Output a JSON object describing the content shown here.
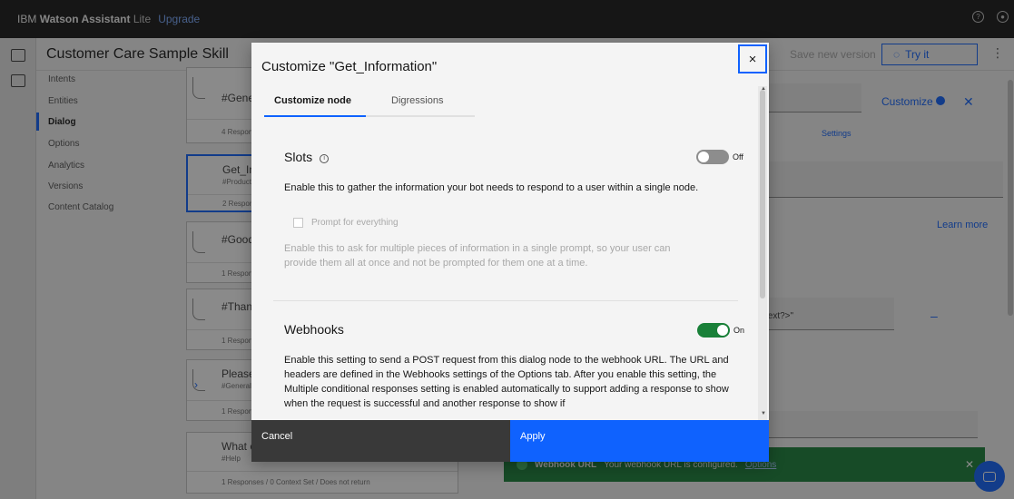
{
  "topbar": {
    "brand_company": "IBM",
    "brand_product": "Watson Assistant",
    "brand_plan": "Lite",
    "upgrade": "Upgrade",
    "help_icon": "help-icon",
    "user_icon": "user-icon"
  },
  "header": {
    "skill_title": "Customer Care Sample Skill",
    "save_version": "Save new version",
    "try_it": "Try it",
    "kebab": "⋮"
  },
  "subnav": {
    "items": [
      {
        "label": "Intents"
      },
      {
        "label": "Entities"
      },
      {
        "label": "Dialog"
      },
      {
        "label": "Options"
      },
      {
        "label": "Analytics"
      },
      {
        "label": "Versions"
      },
      {
        "label": "Content Catalog"
      }
    ]
  },
  "tree": {
    "nodes": [
      {
        "title": "#Gene",
        "condition": "",
        "footer": "4 Respon"
      },
      {
        "title": "Get_In",
        "condition": "#Product",
        "footer": "2 Respon"
      },
      {
        "title": "#Good",
        "condition": "",
        "footer": "1 Respon"
      },
      {
        "title": "#Thank",
        "condition": "",
        "footer": "1 Respon"
      },
      {
        "title": "Please",
        "condition": "#General",
        "footer": "1 Respon"
      },
      {
        "title": "What c",
        "condition": "#Help",
        "footer": "1 Responses / 0 Context Set / Does not return"
      }
    ]
  },
  "right_panel": {
    "customize": "Customize",
    "settings": "Settings",
    "learn_more": "Learn more",
    "context_text": "text?>\"",
    "dash": "–",
    "toast_label": "Webhook URL",
    "toast_msg": "Your webhook URL is configured.",
    "toast_link": "Options"
  },
  "modal": {
    "title": "Customize \"Get_Information\"",
    "close": "×",
    "tabs": [
      {
        "label": "Customize node"
      },
      {
        "label": "Digressions"
      }
    ],
    "slots": {
      "title": "Slots",
      "toggle_label": "Off",
      "description": "Enable this to gather the information your bot needs to respond to a user within a single node.",
      "checkbox_label": "Prompt for everything",
      "checkbox_desc": "Enable this to ask for multiple pieces of information in a single prompt, so your user can provide them all at once and not be prompted for them one at a time."
    },
    "webhooks": {
      "title": "Webhooks",
      "toggle_label": "On",
      "description": "Enable this setting to send a POST request from this dialog node to the webhook URL. The URL and headers are defined in the Webhooks settings of the Options tab. After you enable this setting, the Multiple conditional responses setting is enabled automatically to support adding a response to show when the request is successful and another response to show if"
    },
    "cancel": "Cancel",
    "apply": "Apply"
  },
  "colors": {
    "accent": "#0f62fe",
    "toggle_on": "#198038",
    "toggle_off": "#8d8d8d",
    "topbar": "#161616"
  }
}
